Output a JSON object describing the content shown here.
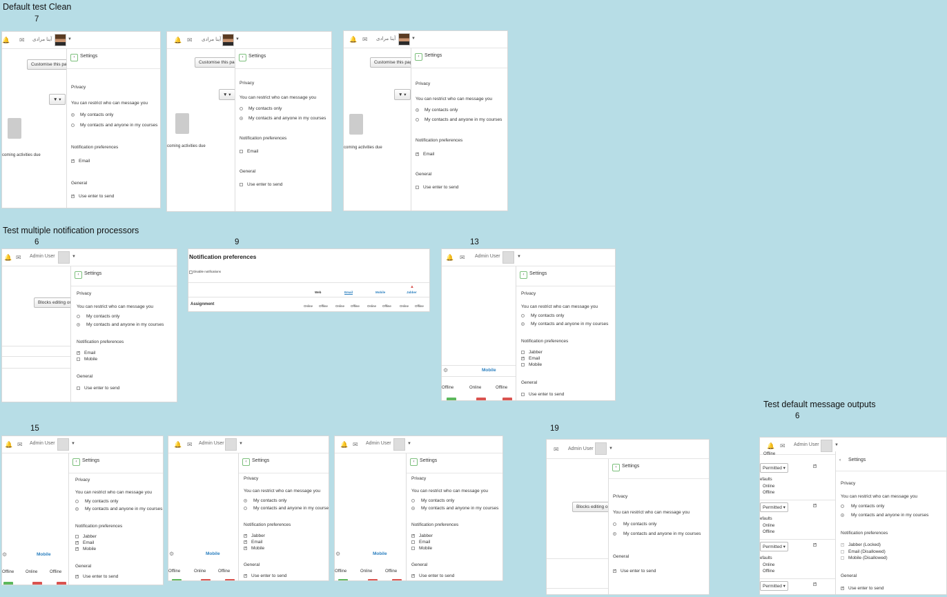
{
  "sections": {
    "clean": "Default test Clean",
    "multi": "Test multiple notification processors",
    "defaults": "Test default message outputs"
  },
  "numbers": {
    "n7": "7",
    "n6a": "6",
    "n9": "9",
    "n13": "13",
    "n15": "15",
    "n19": "19",
    "n6b": "6"
  },
  "user": {
    "arabic": "آینا مرادی",
    "admin": "Admin User"
  },
  "common": {
    "settings": "Settings",
    "privacy": "Privacy",
    "restrict": "You can restrict who can message you",
    "contacts": "My contacts only",
    "anyone": "My contacts and anyone in my courses",
    "notif": "Notification preferences",
    "email": "Email",
    "mobile": "Mobile",
    "jabber": "Jabber",
    "general": "General",
    "enter": "Use enter to send",
    "customise": "Customise this page",
    "blocks": "Blocks editing on",
    "upcoming": "coming activities due",
    "offline": "Offline",
    "online": "Online",
    "permitted": "Permitted",
    "defaults": "efaults",
    "jabber_locked": "Jabber (Locked)",
    "email_dis": "Email (Disallowed)",
    "mobile_dis": "Mobile (Disallowed)"
  },
  "notifprefs": {
    "title": "Notification preferences",
    "disable": "Disable notifications",
    "cols": [
      "Web",
      "Email",
      "Mobile",
      "Jabber"
    ],
    "row": "Assignment",
    "online": "Online",
    "offline": "Offline"
  }
}
